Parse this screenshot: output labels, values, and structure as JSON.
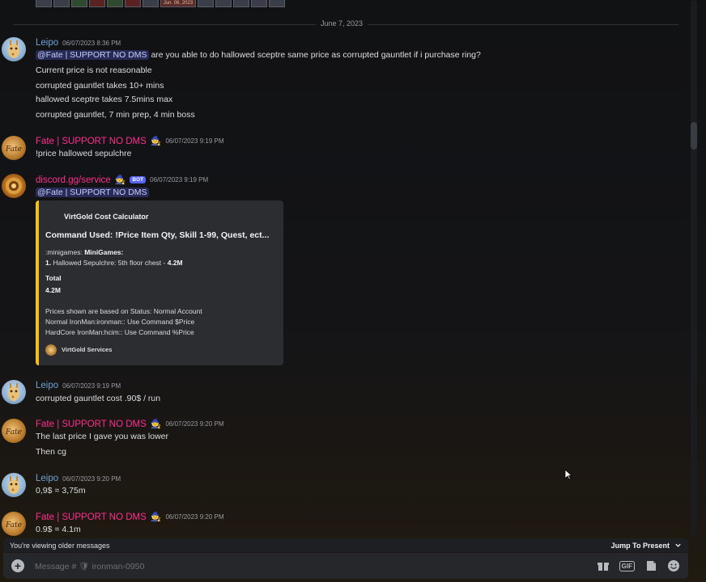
{
  "top_strip": {
    "date_tile": "Jun. 06, 2023"
  },
  "divider": {
    "date": "June 7, 2023"
  },
  "messages": [
    {
      "username": "Leipo",
      "timestamp": "06/07/2023 8:36 PM",
      "lines": [
        {
          "mention": "@Fate | SUPPORT NO DMS",
          "text": " are you able to do hallowed sceptre same price as corrupted gauntlet if i purchase ring?"
        },
        {
          "text": "Current price is not reasonable"
        },
        {
          "text": "corrupted gauntlet takes 10+ mins"
        },
        {
          "text": "hallowed sceptre takes 7.5mins max"
        },
        {
          "text": "corrupted gauntlet, 7 min prep, 4 min boss"
        }
      ]
    },
    {
      "username": "Fate | SUPPORT NO DMS",
      "timestamp": "06/07/2023 9:19 PM",
      "lines": [
        {
          "text": "!price hallowed sepulchre"
        }
      ]
    },
    {
      "username": "discord.gg/service",
      "bot_tag": "BOT",
      "timestamp": "06/07/2023 9:19 PM",
      "lines": [
        {
          "mention": "@Fate | SUPPORT NO DMS"
        }
      ],
      "embed": {
        "author": "VirtGold Cost Calculator",
        "title": "Command Used: !Price Item Qty, Skill 1-99, Quest, ect...",
        "minigames_prefix": ":minigames: ",
        "minigames_label": "MiniGames:",
        "item_num": "1.",
        "item_text": " Hallowed Sepulchre: 5th floor chest - ",
        "item_price": "4.2M",
        "total_label": "Total",
        "total_value": "4.2M",
        "note1": "Prices shown are based on Status: Normal Account",
        "note2": "Normal IronMan:ironman:: Use Command $Price",
        "note3": "HardCore IronMan:hcim:: Use Command %Price",
        "footer": "VirtGold Services"
      }
    },
    {
      "username": "Leipo",
      "timestamp": "06/07/2023 9:19 PM",
      "lines": [
        {
          "text": "corrupted gauntlet cost .90$ / run"
        }
      ]
    },
    {
      "username": "Fate | SUPPORT NO DMS",
      "timestamp": "06/07/2023 9:20 PM",
      "lines": [
        {
          "text": "The last price I gave you was lower"
        },
        {
          "text": "Then cg"
        }
      ]
    },
    {
      "username": "Leipo",
      "timestamp": "06/07/2023 9:20 PM",
      "lines": [
        {
          "text": "0,9$ = 3,75m"
        }
      ]
    },
    {
      "username": "Fate | SUPPORT NO DMS",
      "timestamp": "06/07/2023 9:20 PM",
      "lines": [
        {
          "text": "0.9$ = 4.1m"
        }
      ]
    }
  ],
  "older_bar": {
    "label": "You're viewing older messages",
    "jump_label": "Jump To Present"
  },
  "composer": {
    "placeholder": "Message # 🛡 ironman-0950",
    "gif_label": "GIF"
  },
  "colors": {
    "fate_name": "#ff2e8f",
    "leipo_name": "#6ea3d6",
    "embed_accent": "#f0c020",
    "bot_tag": "#5865f2"
  },
  "icons": [
    "plus-icon",
    "gift-icon",
    "gif-icon",
    "sticker-icon",
    "emoji-icon",
    "chevron-down-icon",
    "mouse-cursor-icon"
  ]
}
